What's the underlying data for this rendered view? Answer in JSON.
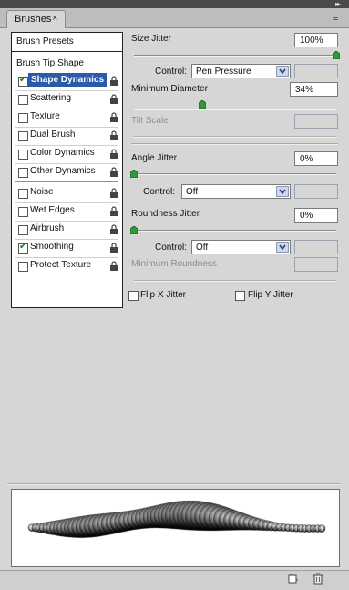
{
  "panel": {
    "tab_label": "Brushes",
    "close_glyph": "×",
    "collapse_glyph": "▸▸",
    "menu_glyph": "≡"
  },
  "left": {
    "presets_label": "Brush Presets",
    "tip_shape_label": "Brush Tip Shape",
    "items": [
      {
        "label": "Shape Dynamics",
        "checked": true,
        "selected": true
      },
      {
        "label": "Scattering",
        "checked": false
      },
      {
        "label": "Texture",
        "checked": false
      },
      {
        "label": "Dual Brush",
        "checked": false
      },
      {
        "label": "Color Dynamics",
        "checked": false
      },
      {
        "label": "Other Dynamics",
        "checked": false
      },
      {
        "label": "Noise",
        "checked": false
      },
      {
        "label": "Wet Edges",
        "checked": false
      },
      {
        "label": "Airbrush",
        "checked": false
      },
      {
        "label": "Smoothing",
        "checked": true
      },
      {
        "label": "Protect Texture",
        "checked": false
      }
    ]
  },
  "controls": {
    "size_jitter_label": "Size Jitter",
    "size_jitter_value": "100%",
    "size_jitter_level": 1.0,
    "control_label": "Control:",
    "size_control_value": "Pen Pressure",
    "min_diameter_label": "Minimum Diameter",
    "min_diameter_value": "34%",
    "min_diameter_level": 0.34,
    "tilt_scale_label": "Tilt Scale",
    "angle_jitter_label": "Angle Jitter",
    "angle_jitter_value": "0%",
    "angle_jitter_level": 0,
    "angle_control_value": "Off",
    "roundness_jitter_label": "Roundness Jitter",
    "roundness_jitter_value": "0%",
    "roundness_jitter_level": 0,
    "roundness_control_value": "Off",
    "min_roundness_label": "Minimum Roundness",
    "flip_x_label": "Flip X Jitter",
    "flip_y_label": "Flip Y Jitter"
  },
  "colors": {
    "selected_bg": "#2a5aa8",
    "check_green": "#1d7a1d",
    "thumb_green": "#2f9a3a"
  }
}
